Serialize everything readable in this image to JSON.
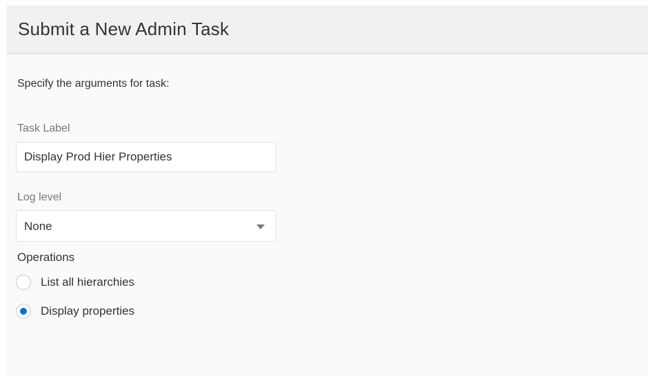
{
  "dialog": {
    "title": "Submit a New Admin Task",
    "intro": "Specify the arguments for task:"
  },
  "task_label": {
    "label": "Task Label",
    "value": "Display Prod Hier Properties"
  },
  "log_level": {
    "label": "Log level",
    "selected": "None",
    "icon": "chevron-down-icon"
  },
  "operations": {
    "label": "Operations",
    "options": [
      {
        "label": "List all hierarchies",
        "checked": false
      },
      {
        "label": "Display properties",
        "checked": true
      }
    ]
  },
  "colors": {
    "accent": "#0572ce",
    "header_bg": "#f1f1f1",
    "panel_bg": "#fafafa"
  }
}
